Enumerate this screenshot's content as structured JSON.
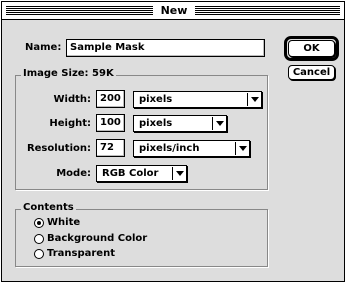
{
  "window": {
    "title": "New"
  },
  "name_field": {
    "label": "Name:",
    "value": "Sample Mask"
  },
  "buttons": {
    "ok": "OK",
    "cancel": "Cancel"
  },
  "image_size": {
    "title": "Image Size: 59K",
    "width": {
      "label": "Width:",
      "value": "200",
      "unit": "pixels"
    },
    "height": {
      "label": "Height:",
      "value": "100",
      "unit": "pixels"
    },
    "resolution": {
      "label": "Resolution:",
      "value": "72",
      "unit": "pixels/inch"
    },
    "mode": {
      "label": "Mode:",
      "value": "RGB Color"
    }
  },
  "contents": {
    "title": "Contents",
    "options": [
      {
        "label": "White",
        "selected": true
      },
      {
        "label": "Background Color",
        "selected": false
      },
      {
        "label": "Transparent",
        "selected": false
      }
    ]
  }
}
